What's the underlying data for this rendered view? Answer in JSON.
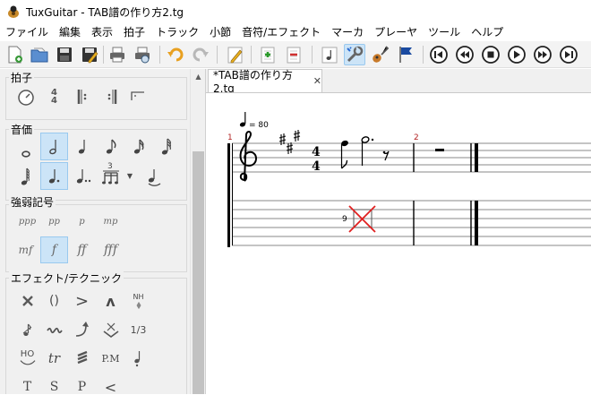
{
  "window": {
    "title": "TuxGuitar - TAB譜の作り方2.tg"
  },
  "menu": [
    "ファイル",
    "編集",
    "表示",
    "拍子",
    "トラック",
    "小節",
    "音符/エフェクト",
    "マーカ",
    "プレーヤ",
    "ツール",
    "ヘルプ"
  ],
  "toolbar": {
    "icons": [
      "new-file-icon",
      "open-file-icon",
      "save-icon",
      "save-as-icon",
      "print-icon",
      "print-preview-icon",
      "undo-icon",
      "redo-icon",
      "edit-pencil-icon",
      "add-measure-icon",
      "remove-measure-icon",
      "note-view-icon",
      "settings-wrench-icon",
      "guitar-icon",
      "flag-icon",
      "first-icon",
      "previous-icon",
      "stop-icon",
      "play-icon",
      "next-icon",
      "last-icon"
    ]
  },
  "panel": {
    "time": {
      "title": "拍子",
      "sig_top": "4",
      "sig_bottom": "4"
    },
    "duration": {
      "title": "音価",
      "tuplet": "3"
    },
    "dynamics": {
      "title": "強弱記号",
      "items": [
        "ppp",
        "pp",
        "p",
        "mp",
        "mf",
        "f",
        "ff",
        "fff"
      ]
    },
    "effects": {
      "title": "エフェクト/テクニック",
      "parens": "()",
      "bracket": ">",
      "hat": "ʌ",
      "nh": "NH",
      "fraction": "1/3",
      "ho": "HO",
      "tr": "tr",
      "pm": "P.M",
      "t": "T",
      "s": "S",
      "p": "P",
      "lt": "<"
    }
  },
  "tab": {
    "label": "*TAB譜の作り方2.tg",
    "close": "✕"
  },
  "score": {
    "tempo": "= 80",
    "measure1": "1",
    "measure2": "2",
    "time_top": "4",
    "time_bottom": "4",
    "fret": "9"
  },
  "colors": {
    "accent": "#cce4f7",
    "accent_border": "#99c9ef",
    "measure_number": "#b22222",
    "cursor": "#e02020"
  }
}
